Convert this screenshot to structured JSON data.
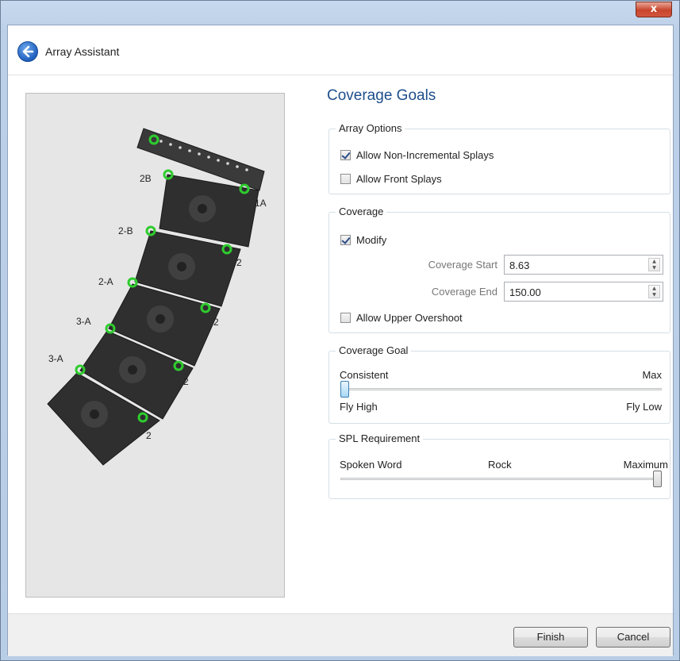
{
  "window": {
    "title": "Array Assistant",
    "close_label": "x"
  },
  "panel_title": "Coverage Goals",
  "array_options": {
    "title": "Array Options",
    "allow_non_incremental": {
      "label": "Allow Non-Incremental Splays",
      "checked": true
    },
    "allow_front": {
      "label": "Allow Front Splays",
      "checked": false
    }
  },
  "coverage": {
    "title": "Coverage",
    "modify": {
      "label": "Modify",
      "checked": true
    },
    "start": {
      "label": "Coverage Start",
      "value": "8.63"
    },
    "end": {
      "label": "Coverage End",
      "value": "150.00"
    },
    "upper_overshoot": {
      "label": "Allow Upper Overshoot",
      "checked": false
    }
  },
  "coverage_goal": {
    "title": "Coverage Goal",
    "left_top": "Consistent",
    "right_top": "Max",
    "left_bottom": "Fly High",
    "right_bottom": "Fly Low",
    "level": 0.0
  },
  "spl": {
    "title": "SPL Requirement",
    "left": "Spoken Word",
    "middle": "Rock",
    "right": "Maximum",
    "level": 1.0
  },
  "preview_labels": {
    "grid_top_left": "2B",
    "grid_top_right": "1A",
    "box1_left": "2-B",
    "box1_right": "2",
    "box2_left": "2-A",
    "box2_right": "2",
    "box3_left": "3-A",
    "box3_right": "2",
    "box4_left": "3-A",
    "box4_right": "2"
  },
  "footer": {
    "finish_label": "Finish",
    "cancel_label": "Cancel"
  }
}
